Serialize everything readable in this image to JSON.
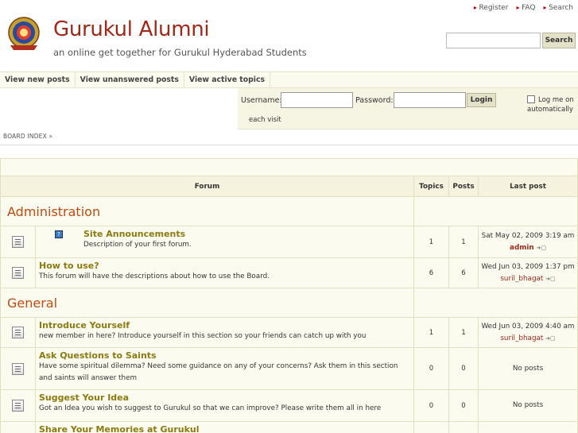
{
  "header": {
    "title": "Gurukul Alumni",
    "description": "an online get together for Gurukul Hyderabad Students"
  },
  "toplinks": [
    "Register",
    "FAQ",
    "Search"
  ],
  "search": {
    "button": "Search",
    "placeholder": ""
  },
  "nav": [
    "View new posts",
    "View unanswered posts",
    "View active topics"
  ],
  "login": {
    "username_label": "Username:",
    "password_label": "Password:",
    "button": "Login",
    "remember": "Log me on automatically",
    "remember_tail": "each visit"
  },
  "breadcrumb": "BOARD INDEX »",
  "table": {
    "col_forum": "Forum",
    "col_topics": "Topics",
    "col_posts": "Posts",
    "col_last": "Last post"
  },
  "categories": [
    {
      "name": "Administration",
      "forums": [
        {
          "name": "Site Announcements",
          "desc": "Description of your first forum.",
          "topics": "1",
          "posts": "1",
          "last_date": "Sat May 02, 2009 3:19 am",
          "last_user": "admin",
          "admin": true,
          "small_icon": "?"
        },
        {
          "name": "How to use?",
          "desc": "This forum will have the descriptions about how to use the Board.",
          "topics": "6",
          "posts": "6",
          "last_date": "Wed Jun 03, 2009 1:37 pm",
          "last_user": "suril_bhagat"
        }
      ]
    },
    {
      "name": "General",
      "forums": [
        {
          "name": "Introduce Yourself",
          "desc": "new member in here? Introduce yourself in this section so your friends can catch up with you",
          "topics": "1",
          "posts": "1",
          "last_date": "Wed Jun 03, 2009 4:40 am",
          "last_user": "suril_bhagat"
        },
        {
          "name": "Ask Questions to Saints",
          "desc": "Have some spiritual dilemma? Need some guidance on any of your concerns? Ask them in this section and saints will answer them",
          "topics": "0",
          "posts": "0",
          "no_posts": "No posts"
        },
        {
          "name": "Suggest Your Idea",
          "desc": "Got an Idea you wish to suggest to Gurukul so that we can improve? Please write them all in here",
          "topics": "0",
          "posts": "0",
          "no_posts": "No posts"
        },
        {
          "name": "Share Your Memories at Gurukul",
          "desc": "",
          "topics": "",
          "posts": ""
        }
      ]
    }
  ]
}
